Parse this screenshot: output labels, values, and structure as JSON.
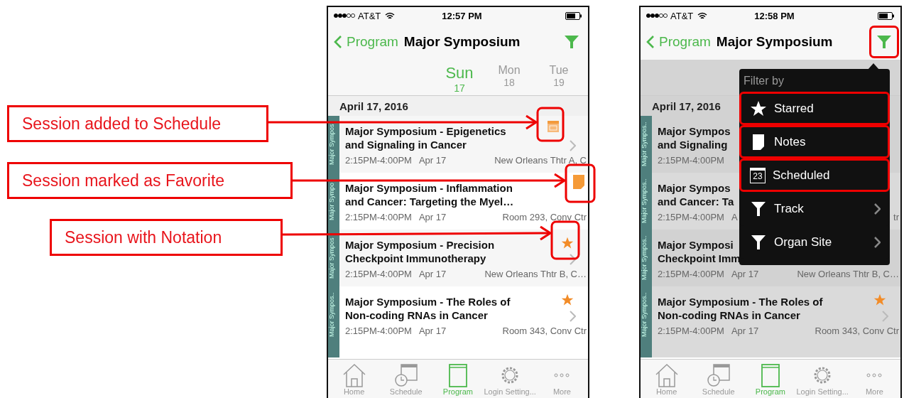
{
  "annotations": [
    {
      "label": "Session added to Schedule"
    },
    {
      "label": "Session marked as Favorite"
    },
    {
      "label": "Session with Notation"
    }
  ],
  "screens": [
    {
      "dimmed": false,
      "status_bar": {
        "carrier": "AT&T",
        "time": "12:57 PM"
      },
      "nav": {
        "back": "Program",
        "title": "Major Symposium",
        "filter_outlined": false
      },
      "days": [
        {
          "day": "Sun",
          "date": "17",
          "selected": true
        },
        {
          "day": "Mon",
          "date": "18",
          "selected": false
        },
        {
          "day": "Tue",
          "date": "19",
          "selected": false
        }
      ],
      "date_header": "April 17, 2016",
      "sessions": [
        {
          "track": "Major Sympos",
          "title_lines": [
            "Major Symposium - Epigenetics",
            "and Signaling in Cancer"
          ],
          "time": "2:15PM-4:00PM",
          "date": "Apr 17",
          "location": "New Orleans Thtr A, C",
          "scheduled": true,
          "noted": false,
          "starred": false
        },
        {
          "track": "Major Sympo",
          "title_lines": [
            "Major Symposium - Inflammation",
            "and Cancer: Targeting the Myel…"
          ],
          "time": "2:15PM-4:00PM",
          "date": "Apr 17",
          "location": "Room 293, Conv Ctr",
          "scheduled": false,
          "noted": true,
          "starred": false
        },
        {
          "track": "Major Sympos",
          "title_lines": [
            "Major Symposium - Precision",
            "Checkpoint Immunotherapy"
          ],
          "time": "2:15PM-4:00PM",
          "date": "Apr 17",
          "location": "New Orleans Thtr B, C…",
          "scheduled": false,
          "noted": false,
          "starred": true
        },
        {
          "track": "Major Sympos..",
          "title_lines": [
            "Major Symposium - The Roles of",
            "Non-coding RNAs in Cancer"
          ],
          "time": "2:15PM-4:00PM",
          "date": "Apr 17",
          "location": "Room 343, Conv Ctr",
          "scheduled": false,
          "noted": false,
          "starred": true
        }
      ],
      "tabs": [
        {
          "label": "Home",
          "kind": "home",
          "selected": false
        },
        {
          "label": "Schedule",
          "kind": "schedule",
          "selected": false
        },
        {
          "label": "Program",
          "kind": "program",
          "selected": true
        },
        {
          "label": "Login Setting...",
          "kind": "gear",
          "selected": false
        },
        {
          "label": "More",
          "kind": "more",
          "selected": false
        }
      ]
    },
    {
      "dimmed": true,
      "status_bar": {
        "carrier": "AT&T",
        "time": "12:58 PM"
      },
      "nav": {
        "back": "Program",
        "title": "Major Symposium",
        "filter_outlined": true
      },
      "date_header": "April 17, 2016",
      "sessions": [
        {
          "track": "Major Sympos..",
          "title_lines": [
            "Major Sympos",
            "and Signaling"
          ],
          "time": "2:15PM-4:00PM"
        },
        {
          "track": "Major Sympos..",
          "title_lines": [
            "Major Sympos",
            "and Cancer: Ta"
          ],
          "time": "2:15PM-4:00PM",
          "date": "A",
          "location": "tr"
        },
        {
          "track": "Major Sympos..",
          "title_lines": [
            "Major Symposi",
            "Checkpoint Imm"
          ],
          "time": "2:15PM-4:00PM",
          "date": "Apr 17",
          "location": "New Orleans Thtr B, C…"
        },
        {
          "track": "Major Sympos..",
          "title_lines": [
            "Major Symposium - The Roles of",
            "Non-coding RNAs in Cancer"
          ],
          "time": "2:15PM-4:00PM",
          "date": "Apr 17",
          "location": "Room 343, Conv Ctr",
          "scheduled": false,
          "noted": false,
          "starred": true
        }
      ],
      "filter_menu": {
        "title": "Filter by",
        "items": [
          {
            "label": "Starred",
            "kind": "star",
            "outlined": true,
            "submenu": false
          },
          {
            "label": "Notes",
            "kind": "note",
            "outlined": true,
            "submenu": false
          },
          {
            "label": "Scheduled",
            "kind": "calendar",
            "icon_text": "23",
            "outlined": true,
            "submenu": false
          },
          {
            "label": "Track",
            "kind": "filter",
            "outlined": false,
            "submenu": true
          },
          {
            "label": "Organ Site",
            "kind": "filter",
            "outlined": false,
            "submenu": true
          }
        ]
      },
      "tabs": [
        {
          "label": "Home",
          "kind": "home",
          "selected": false
        },
        {
          "label": "Schedule",
          "kind": "schedule",
          "selected": false
        },
        {
          "label": "Program",
          "kind": "program",
          "selected": true
        },
        {
          "label": "Login Setting...",
          "kind": "gear",
          "selected": false
        },
        {
          "label": "More",
          "kind": "more",
          "selected": false
        }
      ]
    }
  ]
}
